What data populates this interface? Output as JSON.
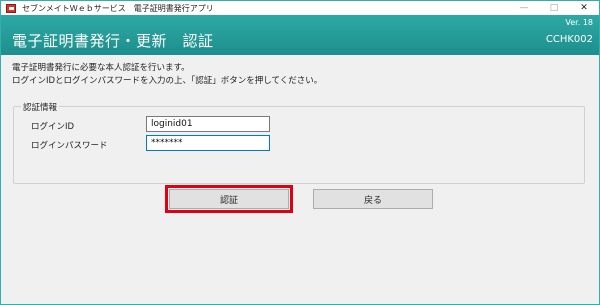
{
  "titlebar": {
    "title": "セブンメイトＷｅｂサービス　電子証明書発行アプリ",
    "minimize": "—",
    "maximize": "□",
    "close": "✕"
  },
  "header": {
    "version": "Ver. 18",
    "title": "電子証明書発行・更新　認証",
    "screen_id": "CCHK002"
  },
  "description": {
    "line1": "電子証明書発行に必要な本人認証を行います。",
    "line2": "ログインIDとログインパスワードを入力の上、「認証」ボタンを押してください。"
  },
  "auth": {
    "legend": "認証情報",
    "login_id_label": "ログインID",
    "login_id_value": "loginid01",
    "password_label": "ログインパスワード",
    "password_value": "*******"
  },
  "buttons": {
    "authenticate": "認証",
    "back": "戻る"
  },
  "colors": {
    "header_teal": "#1d9b98",
    "highlight_red": "#e10012"
  }
}
